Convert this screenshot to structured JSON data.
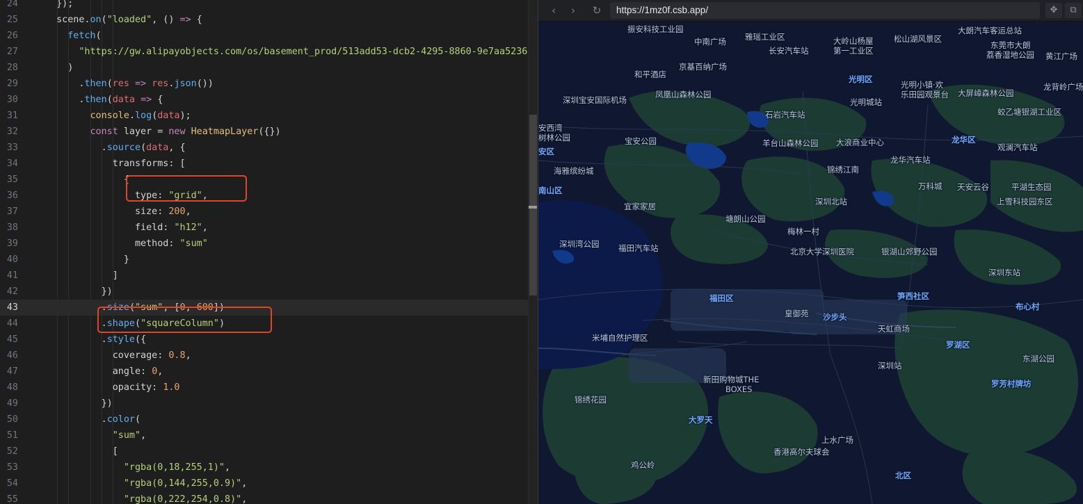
{
  "editor": {
    "lines": [
      {
        "n": "24",
        "t": [
          [
            "tok-plain",
            "  });"
          ]
        ]
      },
      {
        "n": "25",
        "t": [
          [
            "tok-plain",
            "  scene."
          ],
          [
            "tok-fn",
            "on"
          ],
          [
            "tok-plain",
            "("
          ],
          [
            "tok-str",
            "\"loaded\""
          ],
          [
            "tok-plain",
            ", () "
          ],
          [
            "tok-arrow",
            "=>"
          ],
          [
            "tok-plain",
            " {"
          ]
        ]
      },
      {
        "n": "26",
        "t": [
          [
            "tok-plain",
            "    "
          ],
          [
            "tok-fn",
            "fetch"
          ],
          [
            "tok-plain",
            "("
          ]
        ]
      },
      {
        "n": "27",
        "t": [
          [
            "tok-plain",
            "      "
          ],
          [
            "tok-str",
            "\"https://gw.alipayobjects.com/os/basement_prod/513add53-dcb2-4295-8860-9e7aa5236"
          ]
        ]
      },
      {
        "n": "28",
        "t": [
          [
            "tok-plain",
            "    )"
          ]
        ]
      },
      {
        "n": "29",
        "t": [
          [
            "tok-plain",
            "      ."
          ],
          [
            "tok-fn",
            "then"
          ],
          [
            "tok-plain",
            "("
          ],
          [
            "tok-var",
            "res"
          ],
          [
            "tok-plain",
            " "
          ],
          [
            "tok-arrow",
            "=>"
          ],
          [
            "tok-plain",
            " "
          ],
          [
            "tok-var",
            "res"
          ],
          [
            "tok-plain",
            "."
          ],
          [
            "tok-fn",
            "json"
          ],
          [
            "tok-plain",
            "())"
          ]
        ]
      },
      {
        "n": "30",
        "t": [
          [
            "tok-plain",
            "      ."
          ],
          [
            "tok-fn",
            "then"
          ],
          [
            "tok-plain",
            "("
          ],
          [
            "tok-var",
            "data"
          ],
          [
            "tok-plain",
            " "
          ],
          [
            "tok-arrow",
            "=>"
          ],
          [
            "tok-plain",
            " {"
          ]
        ]
      },
      {
        "n": "31",
        "t": [
          [
            "tok-plain",
            "        "
          ],
          [
            "tok-cls",
            "console"
          ],
          [
            "tok-plain",
            "."
          ],
          [
            "tok-fn",
            "log"
          ],
          [
            "tok-plain",
            "("
          ],
          [
            "tok-var",
            "data"
          ],
          [
            "tok-plain",
            ");"
          ]
        ]
      },
      {
        "n": "32",
        "t": [
          [
            "tok-plain",
            "        "
          ],
          [
            "tok-kw",
            "const"
          ],
          [
            "tok-plain",
            " layer = "
          ],
          [
            "tok-kw",
            "new"
          ],
          [
            "tok-plain",
            " "
          ],
          [
            "tok-cls",
            "HeatmapLayer"
          ],
          [
            "tok-plain",
            "({})"
          ]
        ]
      },
      {
        "n": "33",
        "t": [
          [
            "tok-plain",
            "          ."
          ],
          [
            "tok-fn",
            "source"
          ],
          [
            "tok-plain",
            "("
          ],
          [
            "tok-var",
            "data"
          ],
          [
            "tok-plain",
            ", {"
          ]
        ]
      },
      {
        "n": "34",
        "t": [
          [
            "tok-plain",
            "            transforms: ["
          ]
        ]
      },
      {
        "n": "35",
        "t": [
          [
            "tok-plain",
            "              {"
          ]
        ]
      },
      {
        "n": "36",
        "t": [
          [
            "tok-plain",
            "                type: "
          ],
          [
            "tok-str",
            "\"grid\""
          ],
          [
            "tok-plain",
            ","
          ]
        ]
      },
      {
        "n": "37",
        "t": [
          [
            "tok-plain",
            "                size: "
          ],
          [
            "tok-num",
            "200"
          ],
          [
            "tok-plain",
            ","
          ]
        ]
      },
      {
        "n": "38",
        "t": [
          [
            "tok-plain",
            "                field: "
          ],
          [
            "tok-str",
            "\"h12\""
          ],
          [
            "tok-plain",
            ","
          ]
        ]
      },
      {
        "n": "39",
        "t": [
          [
            "tok-plain",
            "                method: "
          ],
          [
            "tok-str",
            "\"sum\""
          ]
        ]
      },
      {
        "n": "40",
        "t": [
          [
            "tok-plain",
            "              }"
          ]
        ]
      },
      {
        "n": "41",
        "t": [
          [
            "tok-plain",
            "            ]"
          ]
        ]
      },
      {
        "n": "42",
        "t": [
          [
            "tok-plain",
            "          })"
          ]
        ]
      },
      {
        "n": "43",
        "t": [
          [
            "tok-plain",
            "          ."
          ],
          [
            "tok-fn",
            "size"
          ],
          [
            "tok-plain",
            "("
          ],
          [
            "tok-str",
            "\"sum\""
          ],
          [
            "tok-plain",
            ", ["
          ],
          [
            "tok-num",
            "0"
          ],
          [
            "tok-plain",
            ", "
          ],
          [
            "tok-num",
            "600"
          ],
          [
            "tok-plain",
            "])"
          ]
        ]
      },
      {
        "n": "44",
        "t": [
          [
            "tok-plain",
            "          ."
          ],
          [
            "tok-fn",
            "shape"
          ],
          [
            "tok-plain",
            "("
          ],
          [
            "tok-str",
            "\"squareColumn\""
          ],
          [
            "tok-plain",
            ")"
          ]
        ]
      },
      {
        "n": "45",
        "t": [
          [
            "tok-plain",
            "          ."
          ],
          [
            "tok-fn",
            "style"
          ],
          [
            "tok-plain",
            "({"
          ]
        ]
      },
      {
        "n": "46",
        "t": [
          [
            "tok-plain",
            "            coverage: "
          ],
          [
            "tok-num",
            "0.8"
          ],
          [
            "tok-plain",
            ","
          ]
        ]
      },
      {
        "n": "47",
        "t": [
          [
            "tok-plain",
            "            angle: "
          ],
          [
            "tok-num",
            "0"
          ],
          [
            "tok-plain",
            ","
          ]
        ]
      },
      {
        "n": "48",
        "t": [
          [
            "tok-plain",
            "            opacity: "
          ],
          [
            "tok-num",
            "1.0"
          ]
        ]
      },
      {
        "n": "49",
        "t": [
          [
            "tok-plain",
            "          })"
          ]
        ]
      },
      {
        "n": "50",
        "t": [
          [
            "tok-plain",
            "          ."
          ],
          [
            "tok-fn",
            "color"
          ],
          [
            "tok-plain",
            "("
          ]
        ]
      },
      {
        "n": "51",
        "t": [
          [
            "tok-plain",
            "            "
          ],
          [
            "tok-str",
            "\"sum\""
          ],
          [
            "tok-plain",
            ","
          ]
        ]
      },
      {
        "n": "52",
        "t": [
          [
            "tok-plain",
            "            ["
          ]
        ]
      },
      {
        "n": "53",
        "t": [
          [
            "tok-plain",
            "              "
          ],
          [
            "tok-str",
            "\"rgba(0,18,255,1)\""
          ],
          [
            "tok-plain",
            ","
          ]
        ]
      },
      {
        "n": "54",
        "t": [
          [
            "tok-plain",
            "              "
          ],
          [
            "tok-str",
            "\"rgba(0,144,255,0.9)\""
          ],
          [
            "tok-plain",
            ","
          ]
        ]
      },
      {
        "n": "55",
        "t": [
          [
            "tok-plain",
            "              "
          ],
          [
            "tok-str",
            "\"rgba(0,222,254,0.8)\""
          ],
          [
            "tok-plain",
            ","
          ]
        ]
      }
    ],
    "current_line": "43",
    "highlight_color": "#e0452c"
  },
  "browser": {
    "back_icon": "chevron-left-icon",
    "forward_icon": "chevron-right-icon",
    "reload_icon": "reload-icon",
    "url": "https://1mz0f.csb.app/",
    "back_glyph": "‹",
    "forward_glyph": "›",
    "reload_glyph": "↻",
    "ext_glyph": "✥",
    "newwin_glyph": "⧉"
  },
  "map": {
    "theme_colors": {
      "background": "#0f1830",
      "land": "#1a3a32",
      "water": "#0c1a4a",
      "roads": "#2c3a55",
      "label": "#b8c6da",
      "district": "#6fa8ff"
    },
    "labels": [
      {
        "text": "振安科技工业园",
        "district": false
      },
      {
        "text": "中南广场",
        "district": false
      },
      {
        "text": "雅瑶工业区",
        "district": false
      },
      {
        "text": "长安汽车站",
        "district": false
      },
      {
        "text": "大岭山杨屋",
        "district": false
      },
      {
        "text": "第一工业区",
        "district": false
      },
      {
        "text": "松山湖风景区",
        "district": false
      },
      {
        "text": "大朗汽车客运总站",
        "district": false
      },
      {
        "text": "东莞市大朗",
        "district": false
      },
      {
        "text": "荔香湿地公园",
        "district": false
      },
      {
        "text": "黄江广场",
        "district": false
      },
      {
        "text": "京基百纳广场",
        "district": false
      },
      {
        "text": "和平酒店",
        "district": false
      },
      {
        "text": "光明区",
        "district": true
      },
      {
        "text": "光明小镇·欢",
        "district": false
      },
      {
        "text": "乐田园观景台",
        "district": false
      },
      {
        "text": "大屏嶂森林公园",
        "district": false
      },
      {
        "text": "龙背岭广场",
        "district": false
      },
      {
        "text": "深圳宝安国际机场",
        "district": false
      },
      {
        "text": "凤凰山森林公园",
        "district": false
      },
      {
        "text": "光明城站",
        "district": false
      },
      {
        "text": "蛟乙塘银湖工业区",
        "district": false
      },
      {
        "text": "石岩汽车站",
        "district": false
      },
      {
        "text": "安西湾",
        "district": false
      },
      {
        "text": "树林公园",
        "district": false
      },
      {
        "text": "宝安公园",
        "district": false
      },
      {
        "text": "羊台山森林公园",
        "district": false
      },
      {
        "text": "大浪商业中心",
        "district": false
      },
      {
        "text": "龙华区",
        "district": true
      },
      {
        "text": "观澜汽车站",
        "district": false
      },
      {
        "text": "安区",
        "district": true
      },
      {
        "text": "龙华汽车站",
        "district": false
      },
      {
        "text": "海雅缤纷城",
        "district": false
      },
      {
        "text": "锦绣江南",
        "district": false
      },
      {
        "text": "万科城",
        "district": false
      },
      {
        "text": "天安云谷",
        "district": false
      },
      {
        "text": "平湖生态园",
        "district": false
      },
      {
        "text": "南山区",
        "district": true
      },
      {
        "text": "深圳北站",
        "district": false
      },
      {
        "text": "上雪科技园东区",
        "district": false
      },
      {
        "text": "宜家家居",
        "district": false
      },
      {
        "text": "塘朗山公园",
        "district": false
      },
      {
        "text": "梅林一村",
        "district": false
      },
      {
        "text": "深圳湾公园",
        "district": false
      },
      {
        "text": "福田汽车站",
        "district": false
      },
      {
        "text": "北京大学深圳医院",
        "district": false
      },
      {
        "text": "银湖山郊野公园",
        "district": false
      },
      {
        "text": "深圳东站",
        "district": false
      },
      {
        "text": "福田区",
        "district": true
      },
      {
        "text": "笋西社区",
        "district": true
      },
      {
        "text": "布心村",
        "district": true
      },
      {
        "text": "皇御苑",
        "district": false
      },
      {
        "text": "沙步头",
        "district": true
      },
      {
        "text": "天虹商场",
        "district": false
      },
      {
        "text": "米埔自然护理区",
        "district": false
      },
      {
        "text": "罗湖区",
        "district": true
      },
      {
        "text": "东湖公园",
        "district": false
      },
      {
        "text": "深圳站",
        "district": false
      },
      {
        "text": "新田购物城THE",
        "district": false
      },
      {
        "text": "BOXES",
        "district": false
      },
      {
        "text": "罗芳村牌坊",
        "district": true
      },
      {
        "text": "锦绣花园",
        "district": false
      },
      {
        "text": "大罗天",
        "district": true
      },
      {
        "text": "上水广场",
        "district": false
      },
      {
        "text": "香港高尔夫球会",
        "district": false
      },
      {
        "text": "鸡公岭",
        "district": false
      },
      {
        "text": "北区",
        "district": true
      }
    ]
  }
}
